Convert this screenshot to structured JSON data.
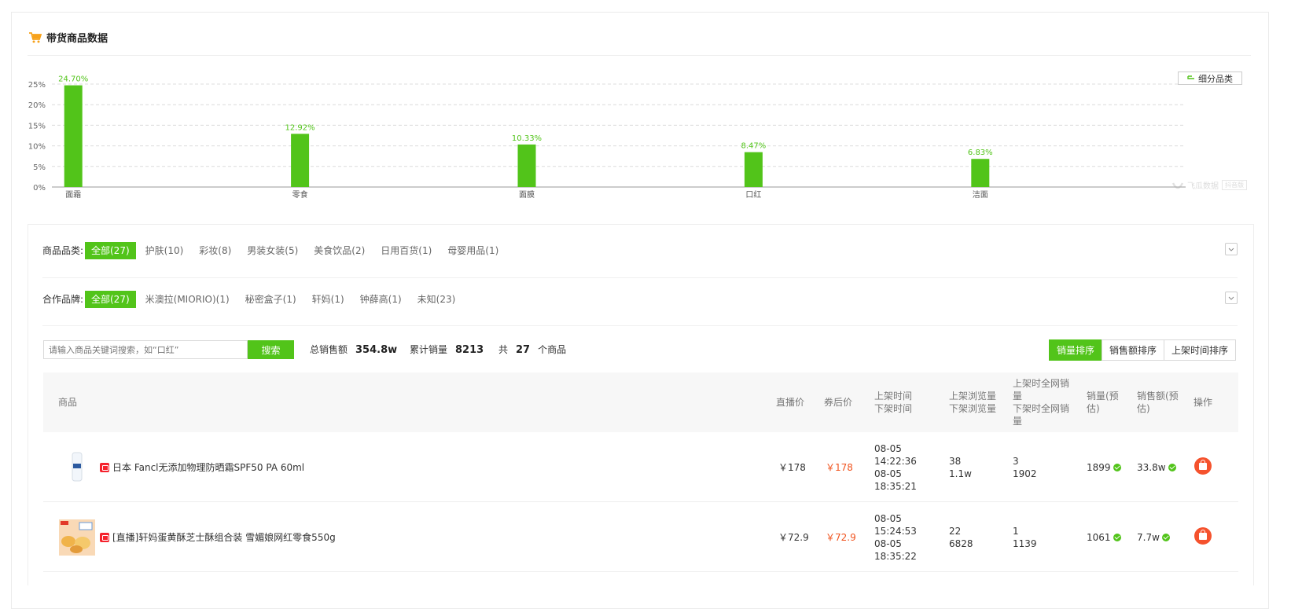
{
  "section": {
    "title": "带货商品数据",
    "icon": "cart-icon"
  },
  "chart_data": {
    "type": "bar",
    "categories": [
      "面霜",
      "零食",
      "面膜",
      "口红",
      "洁面"
    ],
    "values": [
      24.7,
      12.92,
      10.33,
      8.47,
      6.83
    ],
    "data_labels": [
      "24.70%",
      "12.92%",
      "10.33%",
      "8.47%",
      "6.83%"
    ],
    "y_ticks": [
      "0%",
      "5%",
      "10%",
      "15%",
      "20%",
      "25%"
    ],
    "ylim": [
      0,
      25
    ],
    "grid": true,
    "bar_color": "#52c41a"
  },
  "sub_category_button": "细分品类",
  "watermark": {
    "text": "飞瓜数据",
    "badge": "抖音版"
  },
  "filters": {
    "category": {
      "label": "商品品类:",
      "options": [
        "全部(27)",
        "护肤(10)",
        "彩妆(8)",
        "男装女装(5)",
        "美食饮品(2)",
        "日用百货(1)",
        "母婴用品(1)"
      ]
    },
    "brand": {
      "label": "合作品牌:",
      "options": [
        "全部(27)",
        "米澳拉(MIORIO)(1)",
        "秘密盒子(1)",
        "轩妈(1)",
        "钟薛高(1)",
        "未知(23)"
      ]
    }
  },
  "search": {
    "placeholder": "请输入商品关键词搜索，如“口红”",
    "button": "搜索"
  },
  "stats": {
    "total_sales_label": "总销售额",
    "total_sales_value": "354.8w",
    "total_volume_label": "累计销量",
    "total_volume_value": "8213",
    "count_prefix": "共",
    "count_value": "27",
    "count_suffix": "个商品"
  },
  "sort": [
    "销量排序",
    "销售额排序",
    "上架时间排序"
  ],
  "table": {
    "headers": {
      "product": "商品",
      "live_price": "直播价",
      "coupon_price": "券后价",
      "time_1": "上架时间",
      "time_2": "下架时间",
      "views_1": "上架浏览量",
      "views_2": "下架浏览量",
      "net_1": "上架时全网销",
      "net_2": "量",
      "net_3": "下架时全网销",
      "net_4": "量",
      "vol_1": "销量(预",
      "vol_2": "估)",
      "amt_1": "销售额(预",
      "amt_2": "估)",
      "action": "操作"
    },
    "rows": [
      {
        "name": "日本 Fancl无添加物理防晒霜SPF50 PA 60ml",
        "live_price": "￥178",
        "coupon_price": "￥178",
        "on_date": "08-05",
        "on_time": "14:22:36",
        "off_date": "08-05",
        "off_time": "18:35:21",
        "views_on": "38",
        "views_off": "1.1w",
        "net_on": "3",
        "net_off": "1902",
        "volume": "1899",
        "amount": "33.8w"
      },
      {
        "name": "[直播]轩妈蛋黄酥芝士酥组合装 雪媚娘网红零食550g",
        "live_price": "￥72.9",
        "coupon_price": "￥72.9",
        "on_date": "08-05",
        "on_time": "15:24:53",
        "off_date": "08-05",
        "off_time": "18:35:22",
        "views_on": "22",
        "views_off": "6828",
        "net_on": "1",
        "net_off": "1139",
        "volume": "1061",
        "amount": "7.7w"
      }
    ]
  }
}
